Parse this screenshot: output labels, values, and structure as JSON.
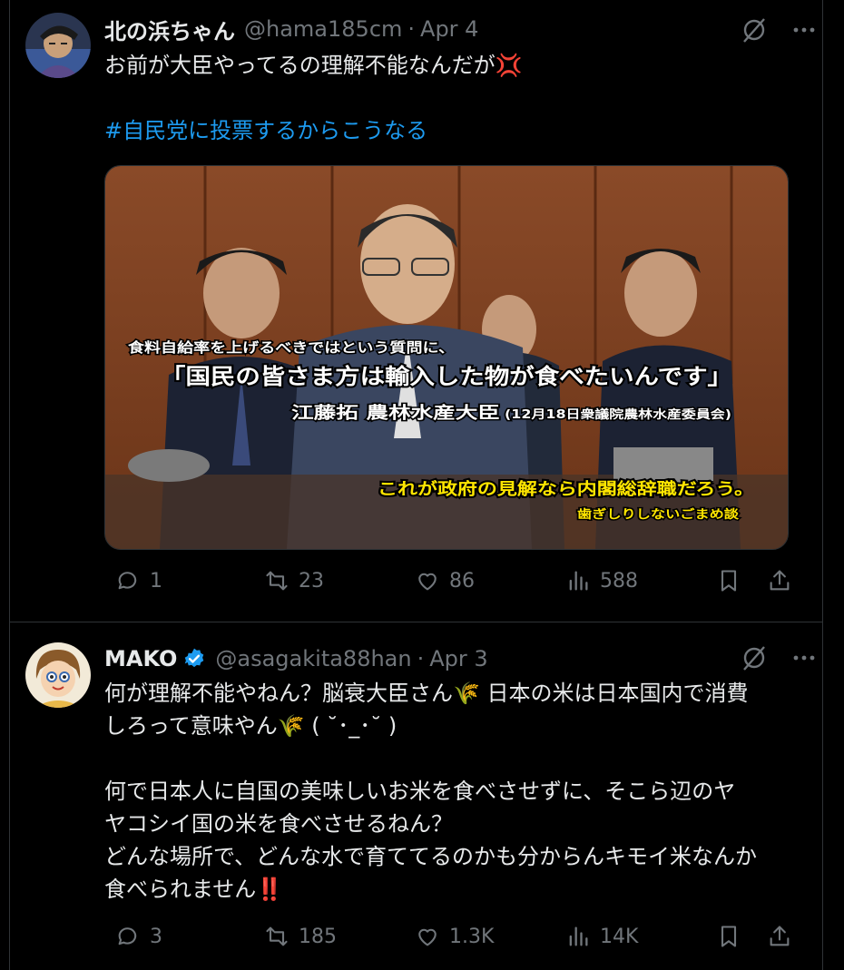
{
  "colors": {
    "background": "#000000",
    "text": "#e7e9ea",
    "muted": "#71767b",
    "link": "#1d9bf0",
    "verified": "#1d9bf0"
  },
  "tweets": [
    {
      "author": {
        "name": "北の浜ちゃん",
        "handle": "@hama185cm",
        "time": "Apr 4",
        "verified": false
      },
      "text_lines": [
        "お前が大臣やってるの理解不能なんだが💢"
      ],
      "hashtag": "#自民党に投票するからこうなる",
      "image": {
        "caption_small": "食料自給率を上げるべきではという質問に、",
        "caption_quote": "「国民の皆さま方は輸入した物が食べたいんです」",
        "caption_speaker": "江藤拓 農林水産大臣",
        "caption_source": "(12月18日衆議院農林水産委員会)",
        "caption_comment": "これが政府の見解なら内閣総辞職だろう。",
        "caption_credit": "歯ぎしりしないごまめ談"
      },
      "stats": {
        "replies": "1",
        "reposts": "23",
        "likes": "86",
        "views": "588"
      },
      "icons": [
        "grok-icon",
        "more-icon",
        "reply-icon",
        "repost-icon",
        "like-icon",
        "views-icon",
        "bookmark-icon",
        "share-icon"
      ]
    },
    {
      "author": {
        "name": "MAKO",
        "handle": "@asagakita88han",
        "time": "Apr 3",
        "verified": true
      },
      "text_lines": [
        "何が理解不能やねん？脳衰大臣さん🌾 日本の米は日本国内で消費",
        "しろって意味やん🌾 ( ˘･_･˘ )",
        "",
        "何で日本人に自国の美味しいお米を食べさせずに、そこら辺のヤ",
        "ヤコシイ国の米を食べさせるねん？",
        "どんな場所で、どんな水で育ててるのかも分からんキモイ米なんか",
        "食べられません‼️"
      ],
      "stats": {
        "replies": "3",
        "reposts": "185",
        "likes": "1.3K",
        "views": "14K"
      }
    }
  ],
  "separator": "·"
}
